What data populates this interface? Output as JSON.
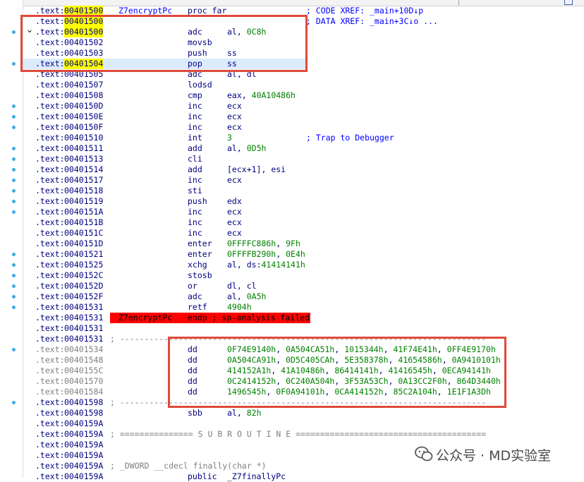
{
  "rows": [
    {
      "addr": "00401500",
      "name": "Z7encryptPc",
      "mnem": "proc far",
      "ops": "",
      "comment": "; CODE XREF: _main+10D↓p",
      "highlight": true
    },
    {
      "addr": "00401500",
      "name": "",
      "mnem": "",
      "ops": "",
      "comment": "; DATA XREF: _main+3C↓o ...",
      "highlight": true
    },
    {
      "addr": "00401500",
      "name": "",
      "mnem": "adc",
      "ops": "al, 0C8h",
      "comment": "",
      "highlight": true
    },
    {
      "addr": "00401502",
      "name": "",
      "mnem": "movsb",
      "ops": "",
      "comment": ""
    },
    {
      "addr": "00401503",
      "name": "",
      "mnem": "push",
      "ops": "ss",
      "comment": ""
    },
    {
      "addr": "00401504",
      "name": "",
      "mnem": "pop",
      "ops": "ss",
      "comment": "",
      "selected": true,
      "highlight": true
    },
    {
      "addr": "00401505",
      "name": "",
      "mnem": "adc",
      "ops": "al, dl",
      "comment": ""
    },
    {
      "addr": "00401507",
      "name": "",
      "mnem": "lodsd",
      "ops": "",
      "comment": ""
    },
    {
      "addr": "00401508",
      "name": "",
      "mnem": "cmp",
      "ops": "eax, 40A10486h",
      "comment": ""
    },
    {
      "addr": "0040150D",
      "name": "",
      "mnem": "inc",
      "ops": "ecx",
      "comment": ""
    },
    {
      "addr": "0040150E",
      "name": "",
      "mnem": "inc",
      "ops": "ecx",
      "comment": ""
    },
    {
      "addr": "0040150F",
      "name": "",
      "mnem": "inc",
      "ops": "ecx",
      "comment": ""
    },
    {
      "addr": "00401510",
      "name": "",
      "mnem": "int",
      "ops": "3",
      "comment": "; Trap to Debugger"
    },
    {
      "addr": "00401511",
      "name": "",
      "mnem": "add",
      "ops": "al, 0D5h",
      "comment": ""
    },
    {
      "addr": "00401513",
      "name": "",
      "mnem": "cli",
      "ops": "",
      "comment": ""
    },
    {
      "addr": "00401514",
      "name": "",
      "mnem": "add",
      "ops": "[ecx+1], esi",
      "comment": ""
    },
    {
      "addr": "00401517",
      "name": "",
      "mnem": "inc",
      "ops": "ecx",
      "comment": ""
    },
    {
      "addr": "00401518",
      "name": "",
      "mnem": "sti",
      "ops": "",
      "comment": ""
    },
    {
      "addr": "00401519",
      "name": "",
      "mnem": "push",
      "ops": "edx",
      "comment": ""
    },
    {
      "addr": "0040151A",
      "name": "",
      "mnem": "inc",
      "ops": "ecx",
      "comment": ""
    },
    {
      "addr": "0040151B",
      "name": "",
      "mnem": "inc",
      "ops": "ecx",
      "comment": ""
    },
    {
      "addr": "0040151C",
      "name": "",
      "mnem": "inc",
      "ops": "ecx",
      "comment": ""
    },
    {
      "addr": "0040151D",
      "name": "",
      "mnem": "enter",
      "ops": "0FFFFC886h, 9Fh",
      "comment": ""
    },
    {
      "addr": "00401521",
      "name": "",
      "mnem": "enter",
      "ops": "0FFFFB290h, 0E4h",
      "comment": ""
    },
    {
      "addr": "00401525",
      "name": "",
      "mnem": "xchg",
      "ops": "al, ds:41414141h",
      "comment": ""
    },
    {
      "addr": "0040152C",
      "name": "",
      "mnem": "stosb",
      "ops": "",
      "comment": ""
    },
    {
      "addr": "0040152D",
      "name": "",
      "mnem": "or",
      "ops": "dl, cl",
      "comment": ""
    },
    {
      "addr": "0040152F",
      "name": "",
      "mnem": "adc",
      "ops": "al, 0A5h",
      "comment": ""
    },
    {
      "addr": "00401531",
      "name": "",
      "mnem": "retf",
      "ops": "4904h",
      "comment": ""
    },
    {
      "addr": "00401531",
      "name": "Z7encryptPc",
      "mnem": "endp ; sp-analysis failed",
      "ops": "",
      "comment": "",
      "error": true
    },
    {
      "addr": "00401531",
      "name": "",
      "mnem": "",
      "ops": "",
      "comment": ""
    },
    {
      "addr": "00401531",
      "name": "",
      "mnem": "",
      "ops": "",
      "comment": "",
      "separator": "; ---------------------------------------------------------------------------"
    },
    {
      "addr": "00401534",
      "name": "",
      "mnem": "dd",
      "ops": "0F74E9140h, 0A504CA51h, 1015344h, 41F74E41h, 0FF4E9170h",
      "comment": "",
      "gray": true
    },
    {
      "addr": "00401548",
      "name": "",
      "mnem": "dd",
      "ops": "0A504CA91h, 0D5C405CAh, 5E358378h, 41654586h, 0A9410101h",
      "comment": "",
      "gray": true
    },
    {
      "addr": "0040155C",
      "name": "",
      "mnem": "dd",
      "ops": "414152A1h, 41A10486h, 86414141h, 41416545h, 0ECA94141h",
      "comment": "",
      "gray": true
    },
    {
      "addr": "00401570",
      "name": "",
      "mnem": "dd",
      "ops": "0C2414152h, 0C240A504h, 3F53A53Ch, 0A13CC2F0h, 864D3440h",
      "comment": "",
      "gray": true
    },
    {
      "addr": "00401584",
      "name": "",
      "mnem": "dd",
      "ops": "1496545h, 0F0A94101h, 0CA414152h, 85C2A104h, 1E1F1A3Dh",
      "comment": "",
      "gray": true
    },
    {
      "addr": "00401598",
      "name": "",
      "mnem": "",
      "ops": "",
      "comment": "",
      "separator": "; ---------------------------------------------------------------------------"
    },
    {
      "addr": "00401598",
      "name": "",
      "mnem": "sbb",
      "ops": "al, 82h",
      "comment": ""
    },
    {
      "addr": "0040159A",
      "name": "",
      "mnem": "",
      "ops": "",
      "comment": ""
    },
    {
      "addr": "0040159A",
      "name": "",
      "mnem": "",
      "ops": "",
      "comment": "",
      "separator": "; =============== S U B R O U T I N E ======================================="
    },
    {
      "addr": "0040159A",
      "name": "",
      "mnem": "",
      "ops": "",
      "comment": ""
    },
    {
      "addr": "0040159A",
      "name": "",
      "mnem": "",
      "ops": "",
      "comment": ""
    },
    {
      "addr": "0040159A",
      "name": "",
      "mnem": "",
      "ops": "",
      "comment": "",
      "separator": "; _DWORD __cdecl finally(char *)"
    },
    {
      "addr": "0040159A",
      "name": "",
      "mnem": "public",
      "ops": "_Z7finallyPc",
      "comment": ""
    }
  ],
  "segment": ".text",
  "watermark": "公众号 · MD实验室",
  "colors": {
    "address_highlight": "#ffff00",
    "error_bar": "#ff0000",
    "annotation_box": "#e0493a",
    "breakpoint_dot": "#41a8e0"
  }
}
